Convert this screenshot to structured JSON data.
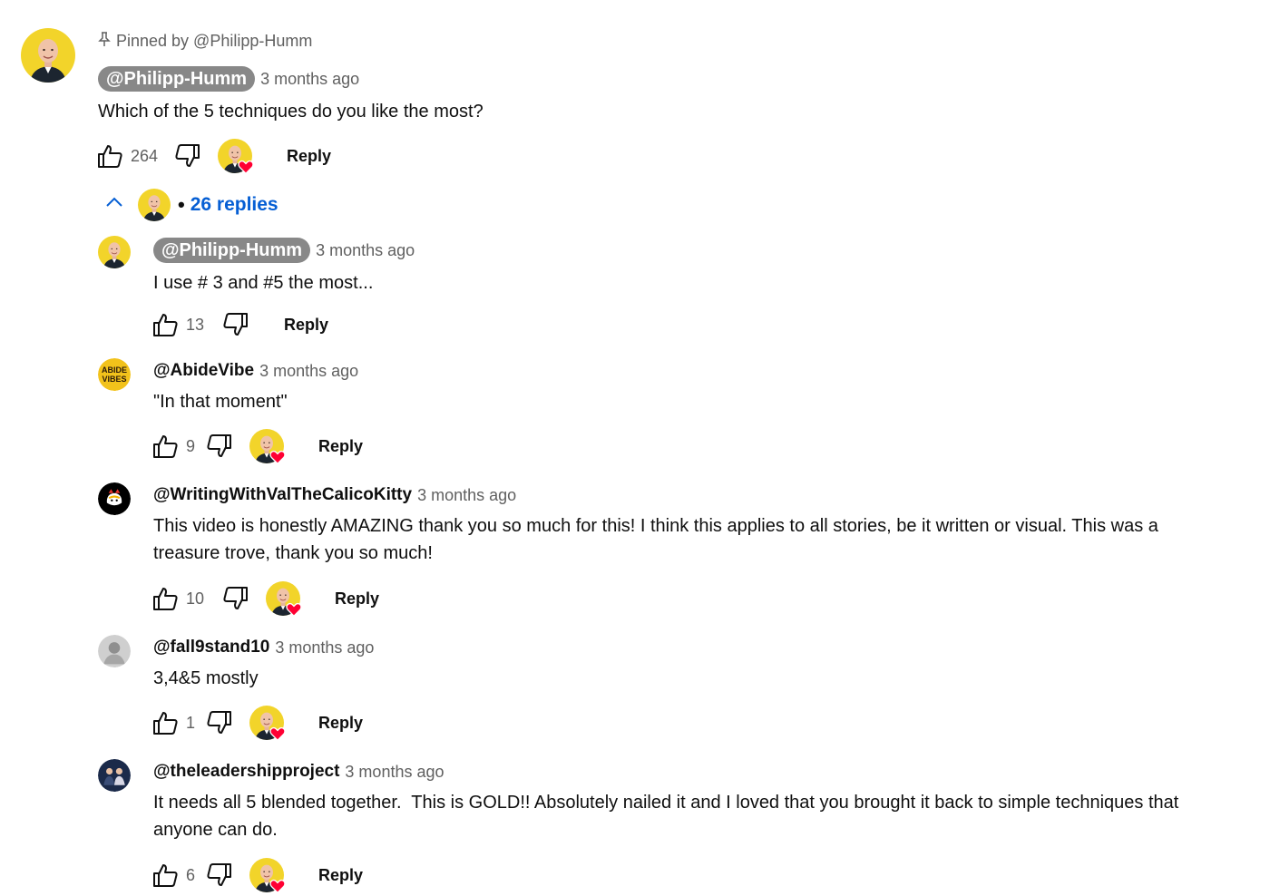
{
  "pinned": {
    "text": "Pinned by @Philipp-Humm"
  },
  "top_comment": {
    "author": "@Philipp-Humm",
    "time": "3 months ago",
    "text": "Which of the 5 techniques do you like the most?",
    "likes": "264",
    "reply_label": "Reply"
  },
  "replies_toggle": {
    "label": "26 replies",
    "separator": "•"
  },
  "replies": [
    {
      "author": "@Philipp-Humm",
      "time": "3 months ago",
      "text": "I use # 3 and #5 the most...",
      "likes": "13",
      "reply_label": "Reply"
    },
    {
      "author": "@AbideVibe",
      "time": "3 months ago",
      "text": "\"In that moment\"",
      "likes": "9",
      "reply_label": "Reply"
    },
    {
      "author": "@WritingWithValTheCalicoKitty",
      "time": "3 months ago",
      "text_line1": "This video is honestly AMAZING thank you so much for this! I think this applies to all stories, be it written or visual. This was a",
      "text_line2": "treasure trove, thank you so much!",
      "likes": "10",
      "reply_label": "Reply"
    },
    {
      "author": "@fall9stand10",
      "time": "3 months ago",
      "text": "3,4&5 mostly",
      "likes": "1",
      "reply_label": "Reply"
    },
    {
      "author": "@theleadershipproject",
      "time": "3 months ago",
      "text_line1": "It needs all 5 blended together.  This is GOLD!! Absolutely nailed it and I loved that you brought it back to simple techniques that",
      "text_line2": "anyone can do.",
      "likes": "6",
      "reply_label": "Reply"
    }
  ],
  "colors": {
    "accent_blue": "#065fd4",
    "heart_red": "#ff0033",
    "muted_text": "#606060",
    "pill_gray": "#888888",
    "avatar_yellow": "#f2d42a"
  }
}
